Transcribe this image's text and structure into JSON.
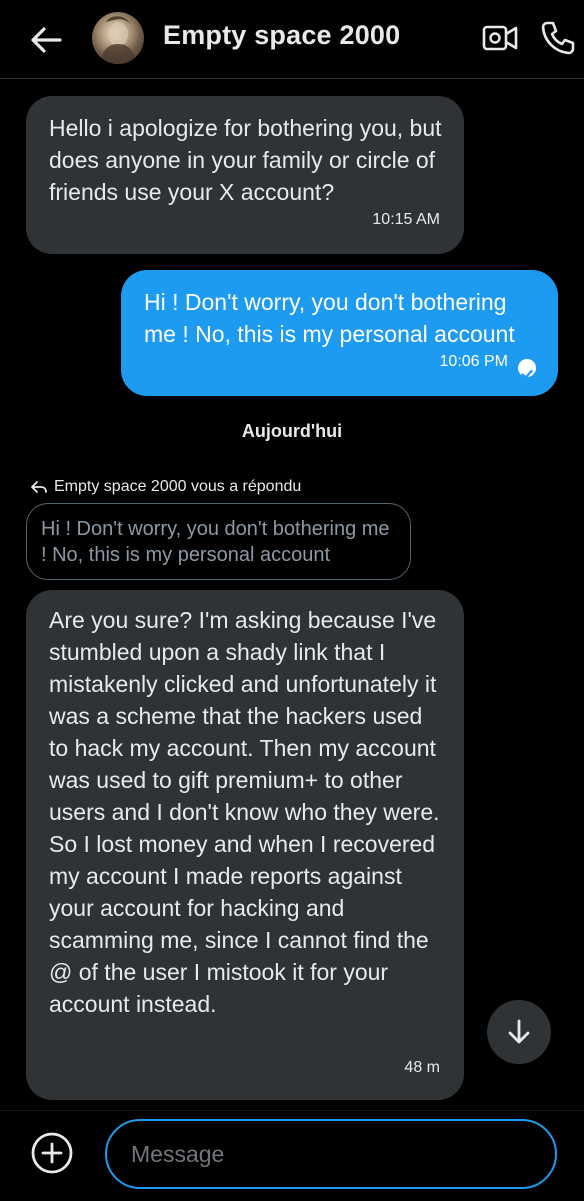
{
  "header": {
    "contact_name": "Empty space 2000"
  },
  "icons": {
    "back": "arrow-left-icon",
    "video": "video-camera-icon",
    "call": "phone-icon",
    "add": "plus-circle-icon",
    "scroll": "arrow-down-icon",
    "reply": "reply-arrow-icon",
    "read": "check-icon"
  },
  "messages": [
    {
      "direction": "incoming",
      "text": "Hello i apologize for bothering you, but does anyone in your family or circle of friends use your X account?",
      "time": "10:15 AM"
    },
    {
      "direction": "outgoing",
      "text": "Hi ! Don't worry, you don't bothering me ! No, this is my personal account",
      "time": "10:06 PM"
    }
  ],
  "day_separator": "Aujourd'hui",
  "reply": {
    "note": "Empty space 2000 vous a répondu",
    "quoted_text": "Hi ! Don't worry, you don't bothering me ! No, this is my personal account"
  },
  "latest_message": {
    "direction": "incoming",
    "text": "Are you sure? I'm asking because I've stumbled upon a shady link that I mistakenly clicked and unfortunately it was a scheme that the hackers used to hack my account. Then my account was used to gift premium+ to other users and I don't know who they were. So I lost money and when I recovered my account I made reports against your account for hacking and scamming me, since I cannot find the @ of the user I mistook it for your account instead.",
    "time": "48 m"
  },
  "composer": {
    "placeholder": "Message",
    "value": ""
  },
  "colors": {
    "accent": "#1d9bf0",
    "incoming_bubble": "#2f3336",
    "background": "#000000"
  }
}
